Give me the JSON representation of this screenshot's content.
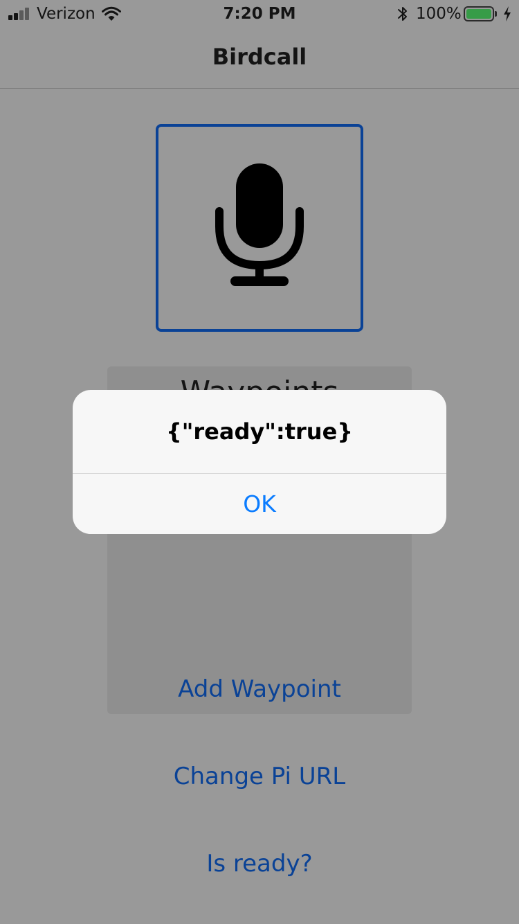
{
  "status_bar": {
    "carrier": "Verizon",
    "time": "7:20 PM",
    "battery_percent": "100%",
    "signal_icon": "cellular-signal-icon",
    "wifi_icon": "wifi-icon",
    "bluetooth_icon": "bluetooth-icon",
    "battery_icon": "battery-icon",
    "charging_icon": "charging-bolt-icon"
  },
  "nav": {
    "title": "Birdcall"
  },
  "main": {
    "mic_icon": "microphone-icon",
    "waypoints_title": "Waypoints",
    "add_waypoint_label": "Add Waypoint",
    "change_pi_url_label": "Change Pi URL",
    "is_ready_label": "Is ready?"
  },
  "alert": {
    "message": "{\"ready\":true}",
    "ok_label": "OK"
  },
  "colors": {
    "dimmed_background": "#999999",
    "accent": "#0a4296",
    "alert_button": "#0a7cff",
    "alert_background": "#f7f7f7",
    "battery_fill": "#4cd964"
  }
}
